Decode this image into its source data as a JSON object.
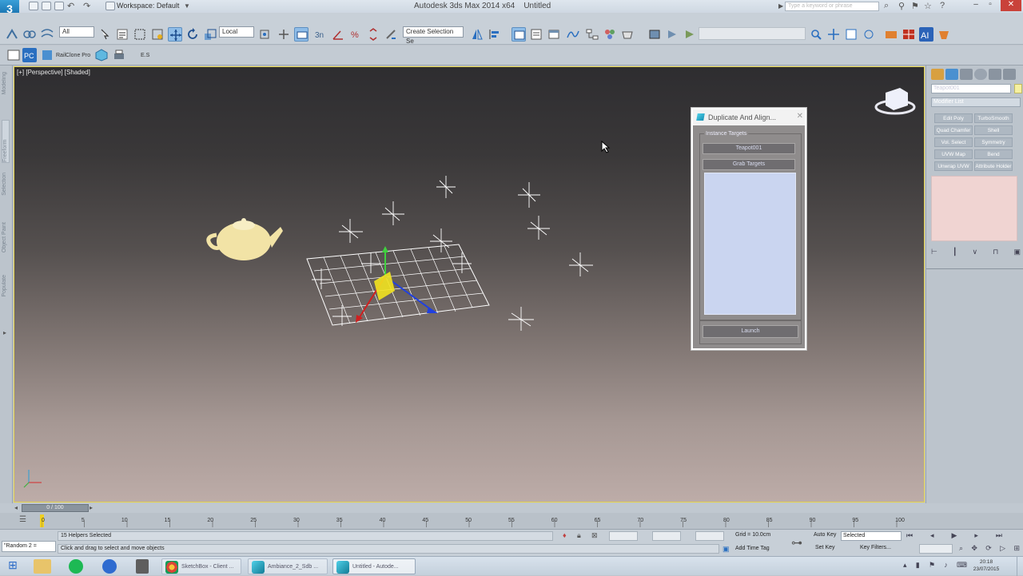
{
  "titlebar": {
    "workspace": "Workspace: Default",
    "title": "Autodesk 3ds Max  2014 x64",
    "doc": "Untitled",
    "search_placeholder": "Type a keyword or phrase"
  },
  "toolbar": {
    "selection_filter": "All",
    "coord_system": "Local",
    "named_selection": "Create Selection Se"
  },
  "toolbar2": {
    "railclone_label": "RailClone Pro",
    "es_label": "E.S"
  },
  "viewport": {
    "label": "[+] [Perspective] [Shaded]"
  },
  "left_tabs": [
    "Modeling",
    "Freeform",
    "Selection",
    "Object Paint",
    "Populate"
  ],
  "dialog": {
    "title": "Duplicate And Align...",
    "group_label": "Instance Targets",
    "picked_object": "Teapot001",
    "grab_label": "Grab Targets",
    "launch_label": "Launch"
  },
  "cmdpanel": {
    "object_name": "Teapot001",
    "modifier_list": "Modifier List",
    "modifiers": [
      "Edit Poly",
      "TurboSmooth",
      "Quad Chamfer",
      "Shell",
      "Vol. Select",
      "Symmetry",
      "UVW Map",
      "Bend",
      "Unwrap UVW",
      "Attribute Holder"
    ]
  },
  "timeline": {
    "frame_counter": "0 / 100",
    "ticks": [
      "0",
      "5",
      "10",
      "15",
      "20",
      "25",
      "30",
      "35",
      "40",
      "45",
      "50",
      "55",
      "60",
      "65",
      "70",
      "75",
      "80",
      "85",
      "90",
      "95",
      "100"
    ]
  },
  "status": {
    "selection_info": "15 Helpers Selected",
    "prompt": "Click and drag to select and move objects",
    "maxscript": "\"Random 2 =",
    "grid": "Grid = 10.0cm",
    "add_time_tag": "Add Time Tag",
    "auto_key": "Auto Key",
    "set_key": "Set Key",
    "key_mode": "Selected",
    "key_filters": "Key Filters..."
  },
  "taskbar": {
    "items": [
      "SketchBox - Client ...",
      "Ambiance_2_Sdb ...",
      "Untitled - Autode..."
    ],
    "clock_time": "20:18",
    "clock_date": "23/07/2015"
  }
}
